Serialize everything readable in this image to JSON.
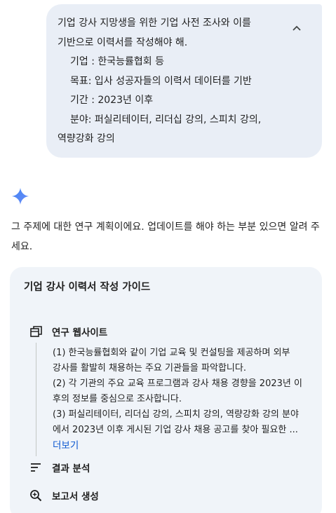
{
  "user_message": {
    "lines": [
      "기업 강사 지망생을 위한 기업 사전 조사와 이를",
      "기반으로 이력서를 작성해야 해.",
      "기업 : 한국능률협회 등",
      "목표: 입사 성공자들의 이력서 데이터를 기반",
      "기간 :  2023년 이후",
      "분야: 퍼실리테이터, 리더십 강의, 스피치 강의,",
      "역량강화 강의"
    ]
  },
  "reply": {
    "text": "그 주제에 대한 연구 계획이에요. 업데이트를 해야 하는 부분 있으면 알려 주세요."
  },
  "plan": {
    "title": "기업 강사 이력서 작성 가이드",
    "steps": [
      {
        "label": "연구 웹사이트",
        "icon": "research-website-icon",
        "lines": [
          "(1) 한국능률협회와 같이 기업 교육 및 컨설팅을 제공하며 외부",
          "강사를 활발히 채용하는 주요 기관들을 파악합니다.",
          "(2) 각 기관의 주요 교육 프로그램과 강사 채용 경향을 2023년 이",
          "후의 정보를 중심으로 조사합니다.",
          "(3) 퍼실리테이터, 리더십 강의, 스피치 강의, 역량강화 강의 분야",
          "에서 2023년 이후 게시된 기업 강사 채용 공고를 찾아 필요한 ..."
        ],
        "more_label": "더보기"
      },
      {
        "label": "결과 분석",
        "icon": "analyze-results-icon"
      },
      {
        "label": "보고서 생성",
        "icon": "create-report-icon"
      }
    ]
  },
  "colors": {
    "bubble_bg": "#e9eef6",
    "card_bg": "#f0f4f9",
    "link": "#0b57d0",
    "gemini_blue": "#4285f4"
  }
}
